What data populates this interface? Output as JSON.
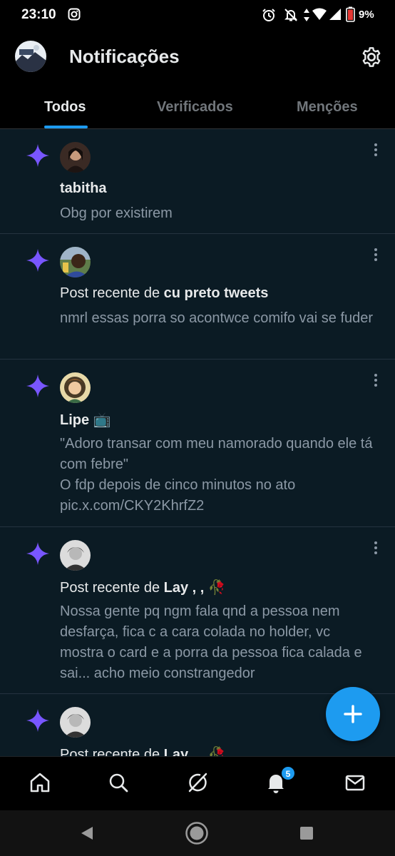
{
  "status_bar": {
    "time": "23:10",
    "battery_percent": "9%",
    "icons": [
      "instagram-icon",
      "alarm-icon",
      "bell-off-icon",
      "data-arrows-icon",
      "wifi-icon",
      "signal-icon",
      "battery-low-icon"
    ]
  },
  "header": {
    "title": "Notificações",
    "icons": [
      "profile-avatar",
      "gear-icon"
    ]
  },
  "tabs": [
    {
      "label": "Todos",
      "active": true
    },
    {
      "label": "Verificados",
      "active": false
    },
    {
      "label": "Menções",
      "active": false
    }
  ],
  "notifications": [
    {
      "title_prefix": "",
      "title_name": "tabitha",
      "body": "Obg por existirem"
    },
    {
      "title_prefix": "Post recente de ",
      "title_name": "cu preto tweets",
      "body": "nmrl essas porra so acontwce comifo vai se fuder"
    },
    {
      "title_prefix": "",
      "title_name": "Lipe 📺",
      "body_lines": [
        "\"Adoro transar com meu namorado quando ele tá com febre\"",
        "O fdp depois de cinco minutos no ato",
        "pic.x.com/CKY2KhrfZ2"
      ]
    },
    {
      "title_prefix": "Post recente de ",
      "title_name": "Lay , , 🥀",
      "body": "Nossa gente pq ngm fala qnd a pessoa nem desfarça, fica c a cara colada no holder, vc mostra o card e a porra da pessoa fica calada e sai... acho meio constrangedor"
    },
    {
      "title_prefix": "Post recente de ",
      "title_name": "Lay , , 🥀",
      "body": ""
    }
  ],
  "bottom_nav": {
    "items": [
      "home-icon",
      "search-icon",
      "grok-icon",
      "notifications-icon",
      "messages-icon"
    ],
    "notification_badge": "5"
  },
  "colors": {
    "accent": "#1d9bf0",
    "sparkle": "#7856ff",
    "feed_bg": "#0b1b24",
    "muted_text": "#8b98a5"
  }
}
